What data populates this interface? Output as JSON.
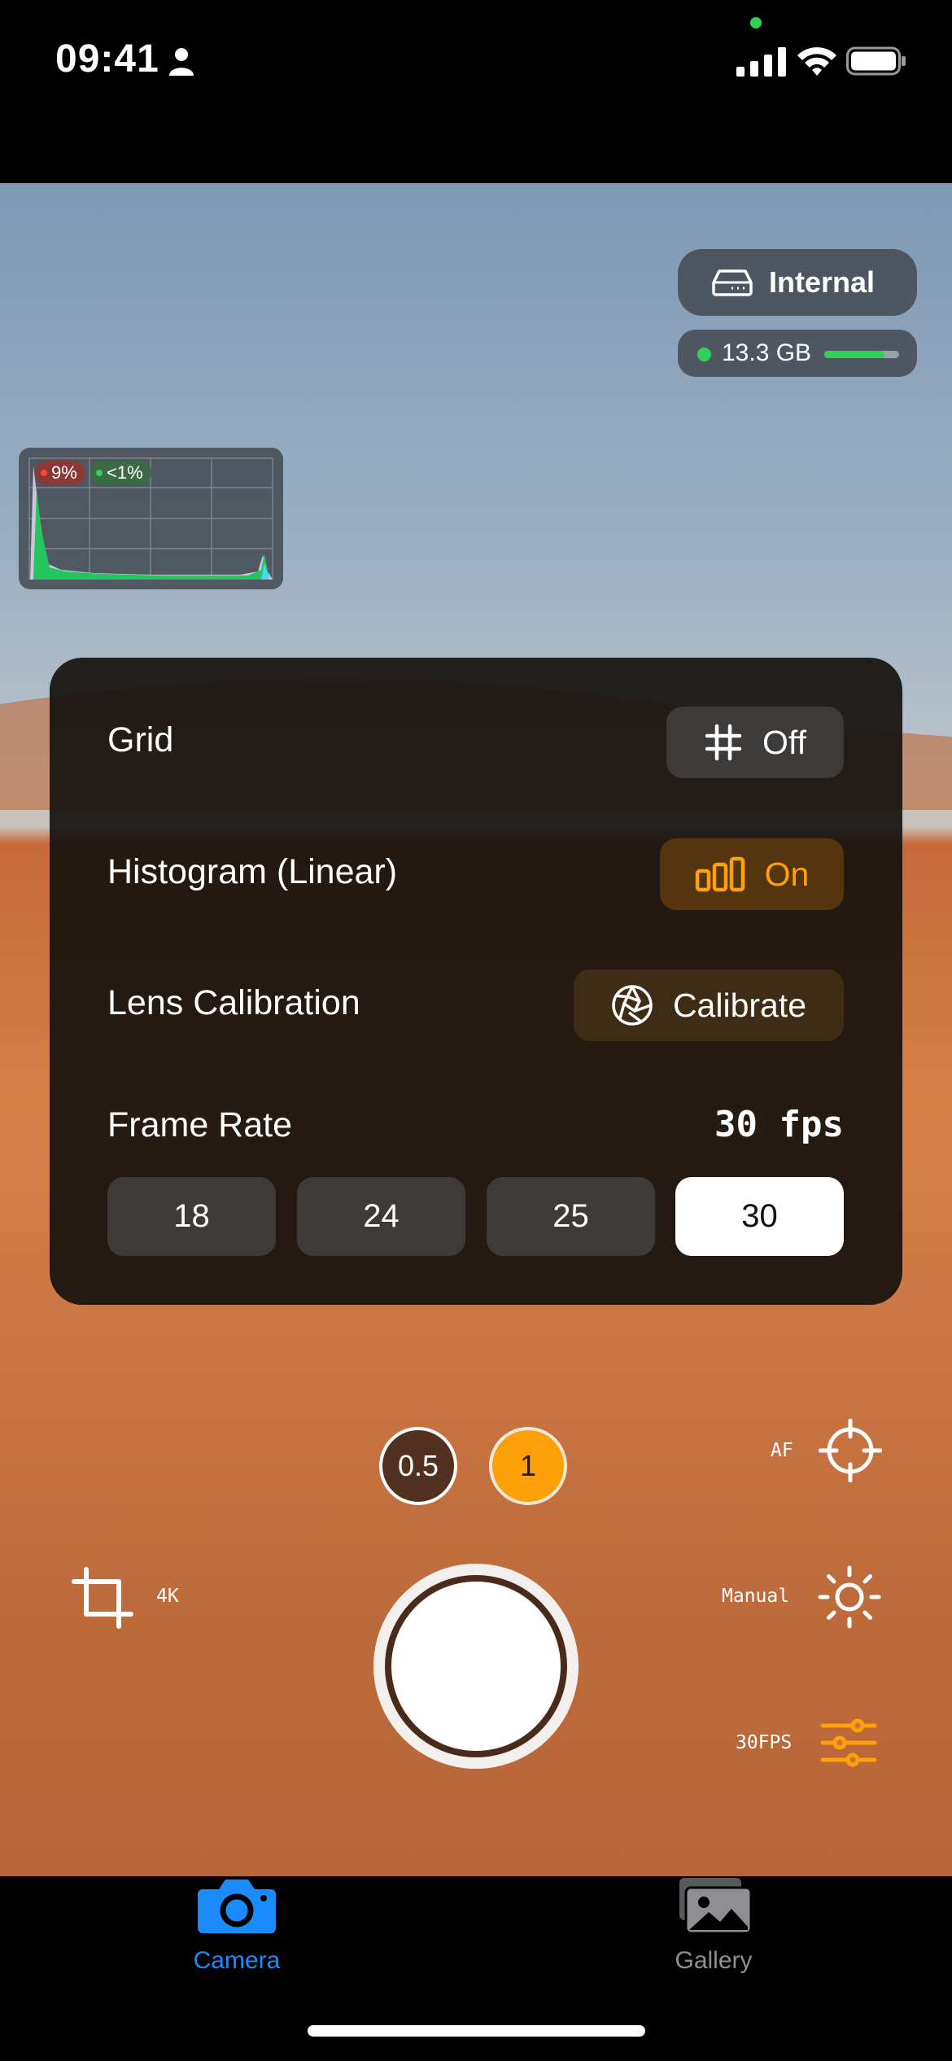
{
  "status_bar": {
    "time": "09:41"
  },
  "storage": {
    "location": "Internal",
    "free_space": "13.3 GB",
    "fill_fraction": 0.8
  },
  "histogram": {
    "clip_high": "9%",
    "clip_low": "<1%"
  },
  "settings": {
    "grid": {
      "label": "Grid",
      "value": "Off"
    },
    "histogram": {
      "label": "Histogram (Linear)",
      "value": "On"
    },
    "lens_calibration": {
      "label": "Lens Calibration",
      "button": "Calibrate"
    },
    "frame_rate": {
      "label": "Frame Rate",
      "value": "30 fps",
      "options": [
        "18",
        "24",
        "25",
        "30"
      ],
      "selected": "30"
    }
  },
  "lenses": [
    {
      "label": "0.5",
      "selected": false
    },
    {
      "label": "1",
      "selected": true
    }
  ],
  "controls": {
    "af": "AF",
    "resolution": "4K",
    "exposure": "Manual",
    "fps": "30FPS"
  },
  "tabs": [
    {
      "label": "Camera",
      "active": true
    },
    {
      "label": "Gallery",
      "active": false
    }
  ],
  "colors": {
    "accent": "#ff9f0a",
    "tab_active": "#1a8cff",
    "status_green": "#30d158"
  }
}
